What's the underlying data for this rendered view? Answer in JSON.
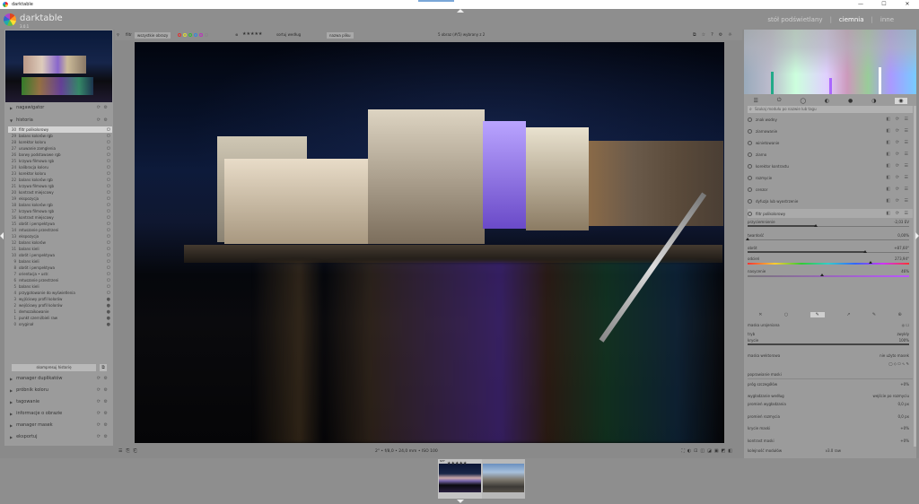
{
  "window": {
    "title": "darktable",
    "minimize": "—",
    "maximize": "☐",
    "close": "✕"
  },
  "header": {
    "brand": "darktable",
    "brand_sub": "3.0.1",
    "views": [
      "stół podświetlany",
      "|",
      "ciemnia",
      "|",
      "inne"
    ],
    "active_view": "ciemnia"
  },
  "filter_bar": {
    "filter_label": "filtr",
    "filter_value": "wszystkie obrazy",
    "rating_filter": "★★★★★",
    "sort_label": "sortuj według",
    "sort_value": "nazwa pliku",
    "selection_info": "5 obraz (#/5) wybrany z 2",
    "color_labels": [
      "#d33",
      "#dd3",
      "#3b3",
      "#38d",
      "#b3b",
      "#888"
    ]
  },
  "left_panel": {
    "sections_top": [
      {
        "label": "nagawigator"
      },
      {
        "label": "historia"
      }
    ],
    "history": [
      {
        "n": "30",
        "label": "filtr polikolorowy",
        "sel": true
      },
      {
        "n": "29",
        "label": "balans kolorów rgb"
      },
      {
        "n": "28",
        "label": "korektor koloru"
      },
      {
        "n": "27",
        "label": "usuwanie zamglenia"
      },
      {
        "n": "26",
        "label": "barwy podstawowe rgb"
      },
      {
        "n": "25",
        "label": "krzywa filmowa rgb"
      },
      {
        "n": "24",
        "label": "kalibracja koloru"
      },
      {
        "n": "23",
        "label": "korektor koloru"
      },
      {
        "n": "22",
        "label": "balans kolorów rgb"
      },
      {
        "n": "21",
        "label": "krzywa filmowa rgb"
      },
      {
        "n": "20",
        "label": "kontrast miejscowy"
      },
      {
        "n": "19",
        "label": "ekspozycja"
      },
      {
        "n": "18",
        "label": "balans kolorów rgb"
      },
      {
        "n": "17",
        "label": "krzywa filmowa rgb"
      },
      {
        "n": "16",
        "label": "kontrast miejscowy"
      },
      {
        "n": "15",
        "label": "obrót i perspektywa"
      },
      {
        "n": "14",
        "label": "retuszanie przestrzeni"
      },
      {
        "n": "13",
        "label": "ekspozycja"
      },
      {
        "n": "12",
        "label": "balans kolorów"
      },
      {
        "n": "11",
        "label": "balans kieli"
      },
      {
        "n": "10",
        "label": "obrót i perspektywa"
      },
      {
        "n": "9",
        "label": "balans kieli"
      },
      {
        "n": "8",
        "label": "obrót i perspektywa"
      },
      {
        "n": "7",
        "label": "orientacja • ustr."
      },
      {
        "n": "6",
        "label": "retuszanie przestrzeni"
      },
      {
        "n": "5",
        "label": "balans kieli"
      },
      {
        "n": "4",
        "label": "przygotowanie do wyświetlenia"
      },
      {
        "n": "3",
        "label": "wyjściowy profil kolorów"
      },
      {
        "n": "2",
        "label": "wejściowy profil kolorów"
      },
      {
        "n": "1",
        "label": "demozaikowanie"
      },
      {
        "n": "1",
        "label": "punkt czerni/bieli raw"
      },
      {
        "n": "0",
        "label": "oryginał"
      }
    ],
    "compress_label": "skompresuj historię",
    "sections_bottom": [
      {
        "label": "manager duplikatów"
      },
      {
        "label": "próbnik koloru"
      },
      {
        "label": "tagowanie"
      },
      {
        "label": "informacje o obrazie"
      },
      {
        "label": "manager masek"
      },
      {
        "label": "eksportuj"
      }
    ]
  },
  "bottom_bar": {
    "info": "2\" • f/8,0 • 24,0 mm • ISO 100"
  },
  "right_panel": {
    "search_placeholder": "Szukaj modułu po nazwie lub tagu",
    "modules": [
      {
        "label": "znak wodny"
      },
      {
        "label": "ziarnowanie"
      },
      {
        "label": "winietowanie"
      },
      {
        "label": "ziarno"
      },
      {
        "label": "korektor kontrastu"
      },
      {
        "label": "rozmycie"
      },
      {
        "label": "cenzor"
      },
      {
        "label": "dyfuzja lub wyostrzenie"
      }
    ],
    "open_module": "filtr polikolorowy",
    "sliders": [
      {
        "label": "przyciemnienie",
        "value": "-2,03 EV",
        "pos": 0.42
      },
      {
        "label": "twardość",
        "value": "0,00%",
        "pos": 0.0
      },
      {
        "label": "obrót",
        "value": "+87,60°",
        "pos": 0.73
      },
      {
        "label": "odcień",
        "value": "273,94°",
        "pos": 0.76
      },
      {
        "label": "nasycenie",
        "value": "46%",
        "pos": 0.46
      }
    ],
    "mask_label": "maska urojeniana",
    "mask_tryb_label": "tryb",
    "mask_tryb_value": "zwykły",
    "mask_krycie_label": "krycie",
    "mask_krycie_value": "100%",
    "mask_vector_label": "maska wektorowa",
    "mask_vector_value": "nie użyto masek",
    "refine_label": "poprawianie maski",
    "refine_rows": [
      {
        "label": "próg szczegółów",
        "value": "+0%"
      },
      {
        "label": "wygładzanie według",
        "value": "wejście po rozmyciu"
      },
      {
        "label": "promień wygładzania",
        "value": "0,0 px"
      },
      {
        "label": "promień rozmycia",
        "value": "0,0 px"
      },
      {
        "label": "krycie maski",
        "value": "+0%"
      },
      {
        "label": "kontrast maski",
        "value": "+0%"
      }
    ],
    "bottom_modules": [
      {
        "label": "połącz"
      },
      {
        "label": "powiększ obszar"
      }
    ],
    "footer_label": "kolejność modułów",
    "footer_value": "v3.0 raw"
  },
  "filmstrip": {
    "thumb_tag": "NEF",
    "stars": "★★★★★"
  }
}
